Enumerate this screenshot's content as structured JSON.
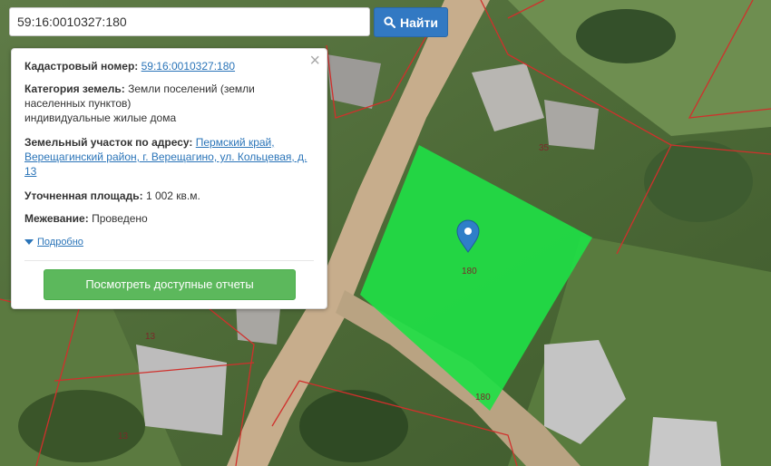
{
  "search": {
    "value": "59:16:0010327:180",
    "button_label": "Найти"
  },
  "info": {
    "cadastral_label": "Кадастровый номер:",
    "cadastral_value": "59:16:0010327:180",
    "category_label": "Категория земель:",
    "category_value_line1": "Земли поселений (земли",
    "category_value_line2": "населенных пунктов)",
    "category_value_line3": "индивидуальные жилые дома",
    "address_label": "Земельный участок по адресу:",
    "address_value_line1": "Пермский край,",
    "address_value_line2": "Верещагинский район, г. Верещагино, ул. Кольцевая, д.",
    "address_value_line3": "13",
    "area_label": "Уточненная площадь:",
    "area_value": "1 002 кв.м.",
    "survey_label": "Межевание:",
    "survey_value": "Проведено",
    "details_link": "Подробно",
    "report_button": "Посмотреть доступные отчеты"
  },
  "map": {
    "labels": [
      "35",
      "13",
      "13",
      "180",
      "180"
    ],
    "parcel_color": "#1fde45",
    "boundary_color": "#d0302c",
    "marker_color": "#2f7fc8"
  }
}
